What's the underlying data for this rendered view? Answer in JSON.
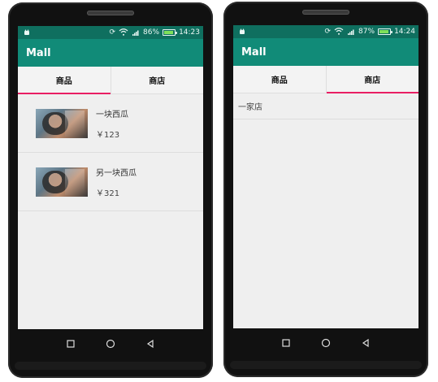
{
  "left_phone": {
    "status": {
      "battery_percent": "86%",
      "time": "14:23"
    },
    "app_title": "Mall",
    "tabs": [
      {
        "label": "商品",
        "active": true
      },
      {
        "label": "商店",
        "active": false
      }
    ],
    "products": [
      {
        "name": "一块西瓜",
        "price": "￥123"
      },
      {
        "name": "另一块西瓜",
        "price": "￥321"
      }
    ]
  },
  "right_phone": {
    "status": {
      "battery_percent": "87%",
      "time": "14:24"
    },
    "app_title": "Mall",
    "tabs": [
      {
        "label": "商品",
        "active": false
      },
      {
        "label": "商店",
        "active": true
      }
    ],
    "shops": [
      {
        "name": "一家店"
      }
    ]
  },
  "colors": {
    "status_bar": "#0f6f5f",
    "app_bar": "#118b78",
    "tab_indicator": "#e91e63",
    "screen_bg": "#efefef"
  },
  "icons": {
    "status_left": "android-icon",
    "status_right": [
      "sync-icon",
      "wifi-icon",
      "signal-icon",
      "battery-icon"
    ],
    "nav": [
      "square-icon",
      "circle-icon",
      "triangle-icon"
    ]
  }
}
